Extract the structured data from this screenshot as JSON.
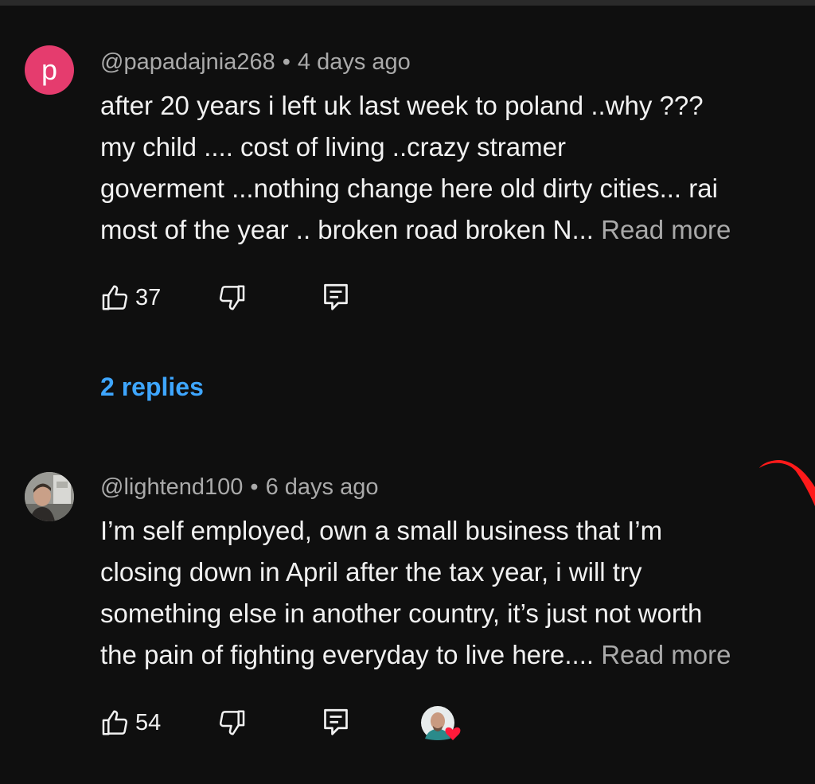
{
  "comments": [
    {
      "author": "@papadajnia268",
      "separator": "•",
      "time": "4 days ago",
      "avatar_letter": "p",
      "avatar_color": "#e53c6e",
      "lines": [
        "after 20 years i left uk last week to poland ..why ???",
        "my child .... cost of living ..crazy stramer",
        "goverment ...nothing change here old dirty cities... rai",
        "most of the year .. broken road broken N... "
      ],
      "read_more": "Read more",
      "likes": "37",
      "replies": "2 replies"
    },
    {
      "author": "@lightend100",
      "separator": "•",
      "time": "6 days ago",
      "lines": [
        "I’m self employed, own a small business that I’m",
        "closing down in April after the tax year, i will try",
        "something else in another country, it’s just not worth",
        "the pain of fighting everyday to live here.... "
      ],
      "read_more": "Read more",
      "likes": "54"
    }
  ],
  "icons": {
    "like": "thumbs-up-icon",
    "dislike": "thumbs-down-icon",
    "reply": "reply-comment-icon",
    "creator_heart": "creator-heart-icon"
  },
  "colors": {
    "background": "#0f0f0f",
    "link": "#3ea6ff",
    "meta": "#aaaaaa",
    "heart": "#ff1a3a"
  }
}
